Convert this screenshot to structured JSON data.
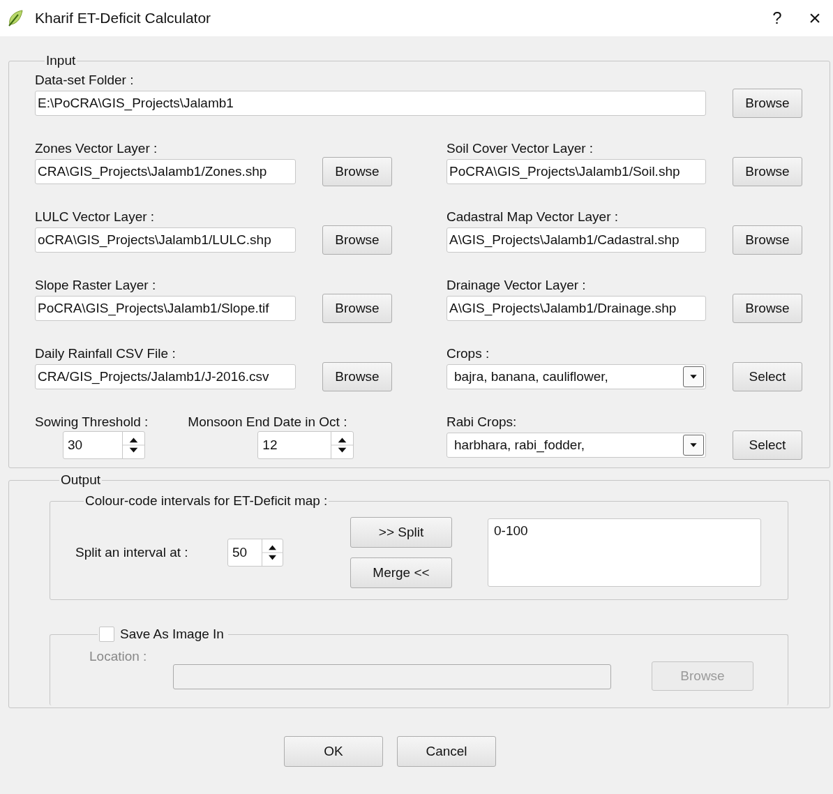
{
  "window": {
    "title": "Kharif ET-Deficit Calculator",
    "help": "?",
    "close": "×"
  },
  "input": {
    "title": "Input",
    "folder": {
      "label": "Data-set Folder :",
      "value": "E:\\PoCRA\\GIS_Projects\\Jalamb1",
      "button": "Browse"
    },
    "rows": [
      [
        {
          "kind": "file",
          "label": "Zones Vector Layer :",
          "value": "CRA\\GIS_Projects\\Jalamb1/Zones.shp",
          "button": "Browse"
        },
        {
          "kind": "file",
          "label": "Soil Cover Vector Layer :",
          "value": "PoCRA\\GIS_Projects\\Jalamb1/Soil.shp",
          "button": "Browse"
        }
      ],
      [
        {
          "kind": "file",
          "label": "LULC Vector Layer :",
          "value": "oCRA\\GIS_Projects\\Jalamb1/LULC.shp",
          "button": "Browse"
        },
        {
          "kind": "file",
          "label": "Cadastral Map Vector Layer :",
          "value": "A\\GIS_Projects\\Jalamb1/Cadastral.shp",
          "button": "Browse"
        }
      ],
      [
        {
          "kind": "file",
          "label": "Slope Raster Layer :",
          "value": "PoCRA\\GIS_Projects\\Jalamb1/Slope.tif",
          "button": "Browse"
        },
        {
          "kind": "file",
          "label": "Drainage Vector Layer :",
          "value": "A\\GIS_Projects\\Jalamb1/Drainage.shp",
          "button": "Browse"
        }
      ],
      [
        {
          "kind": "file",
          "label": "Daily Rainfall CSV File :",
          "value": "CRA/GIS_Projects/Jalamb1/J-2016.csv",
          "button": "Browse"
        },
        {
          "kind": "combo",
          "label": "Crops :",
          "value": "bajra, banana, cauliflower,",
          "button": "Select"
        }
      ],
      [
        {
          "kind": "spins",
          "items": [
            {
              "label": "Sowing Threshold :",
              "value": "30"
            },
            {
              "label": "Monsoon End Date in Oct :",
              "value": "12"
            }
          ]
        },
        {
          "kind": "combo",
          "label": "Rabi Crops:",
          "value": "harbhara, rabi_fodder,",
          "button": "Select"
        }
      ]
    ]
  },
  "output": {
    "title": "Output",
    "intervals": {
      "title": "Colour-code intervals for ET-Deficit map :",
      "split_label": "Split an interval at :",
      "split_value": "50",
      "split_button": ">> Split",
      "merge_button": "Merge <<",
      "list": [
        "0-100"
      ]
    },
    "save": {
      "title": "Save As Image In",
      "checked": false,
      "disabled": true,
      "location_label": "Location :",
      "button": "Browse"
    }
  },
  "buttons": [
    "OK",
    "Cancel"
  ]
}
